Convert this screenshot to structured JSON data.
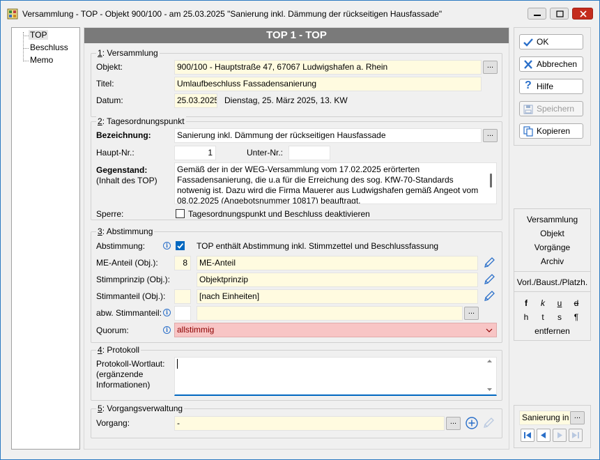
{
  "window": {
    "title": "Versammlung - TOP - Objekt 900/100 - am 25.03.2025 \"Sanierung inkl. Dämmung der rückseitigen Hausfassade\""
  },
  "tree": {
    "items": [
      "TOP",
      "Beschluss",
      "Memo"
    ]
  },
  "header": {
    "title": "TOP 1 - TOP"
  },
  "versammlung": {
    "section_num": "1",
    "section_title": ": Versammlung",
    "objekt_label": "Objekt:",
    "objekt_value": "900/100 - Hauptstraße 47, 67067 Ludwigshafen a. Rhein",
    "titel_label": "Titel:",
    "titel_value": "Umlaufbeschluss Fassadensanierung",
    "datum_label": "Datum:",
    "datum_value": "25.03.2025",
    "datum_info": "Dienstag,  25. März 2025,  13. KW"
  },
  "tagesordnung": {
    "section_num": "2",
    "section_title": ": Tagesordnungspunkt",
    "bezeichnung_label": "Bezeichnung:",
    "bezeichnung_value": "Sanierung inkl. Dämmung der rückseitigen Hausfassade",
    "hauptnr_label": "Haupt-Nr.:",
    "hauptnr_value": "1",
    "释unternr_label": "Unter-Nr.:",
    "unternr_label": "Unter-Nr.:",
    "unternr_value": "",
    "gegenstand_label": "Gegenstand:",
    "gegenstand_sub": "(Inhalt des TOP)",
    "gegenstand_lines": [
      "Gemäß der in der WEG-Versammlung vom 17.02.2025 erörterten",
      "Fassadensanierung, die u.a für die Erreichung des sog. KfW-70-Standards",
      "notwenig ist. Dazu wird die Firma Mauerer aus Ludwigshafen gemäß Angeot vom",
      "08.02.2025 (Angebotsnummer 10817) beauftragt."
    ],
    "sperre_label": "Sperre:",
    "sperre_text": "Tagesordnungspunkt und Beschluss deaktivieren"
  },
  "abstimmung": {
    "section_num": "3",
    "section_title": ": Abstimmung",
    "abstimmung_label": "Abstimmung:",
    "abstimmung_text": "TOP enthält Abstimmung inkl. Stimmzettel und Beschlussfassung",
    "me_label": "ME-Anteil (Obj.):",
    "me_num": "8",
    "me_value": "ME-Anteil",
    "stimmprinzip_label": "Stimmprinzip (Obj.):",
    "stimmprinzip_value": "Objektprinzip",
    "stimmanteil_label": "Stimmanteil (Obj.):",
    "stimmanteil_value": "[nach Einheiten]",
    "abw_label": "abw. Stimmanteil:",
    "abw_value": "",
    "quorum_label": "Quorum:",
    "quorum_value": "allstimmig"
  },
  "protokoll": {
    "section_num": "4",
    "section_title": ": Protokoll",
    "label_lines": [
      "Protokoll-Wortlaut:",
      "(ergänzende",
      "Informationen)"
    ],
    "value": ""
  },
  "vorgang": {
    "section_num": "5",
    "section_title": ": Vorgangsverwaltung",
    "label": "Vorgang:",
    "value": "-"
  },
  "buttons": {
    "ok": "OK",
    "abbrechen": "Abbrechen",
    "hilfe": "Hilfe",
    "speichern": "Speichern",
    "kopieren": "Kopieren"
  },
  "side_nav": {
    "links": [
      "Versammlung",
      "Objekt",
      "Vorgänge",
      "Archiv"
    ],
    "vorl": "Vorl./Baust./Platzh.",
    "fmt_row1": [
      "f",
      "k",
      "u",
      "d"
    ],
    "fmt_row2": [
      "h",
      "t",
      "s",
      "¶"
    ],
    "entfernen": "entfernen"
  },
  "bottom_nav": {
    "search_value": "Sanierung in"
  },
  "colors": {
    "accent": "#0067c0",
    "field_yellow": "#fffbe0",
    "quorum_red": "#f8c5c5",
    "header_gray": "#7a7a7a"
  }
}
